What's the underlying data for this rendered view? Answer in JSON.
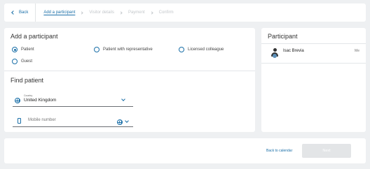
{
  "nav": {
    "back": "Back",
    "steps": [
      "Add a participant",
      "Visitor details",
      "Payment",
      "Confirm"
    ]
  },
  "add_participant": {
    "title": "Add a participant",
    "options": [
      {
        "label": "Patient",
        "selected": true
      },
      {
        "label": "Patient with representative",
        "selected": false
      },
      {
        "label": "Licensed colleague",
        "selected": false
      },
      {
        "label": "Guest",
        "selected": false
      }
    ]
  },
  "find_patient": {
    "title": "Find patient",
    "country_label": "Country",
    "country_value": "United Kingdom",
    "mobile_placeholder": "Mobile number"
  },
  "participant_panel": {
    "title": "Participant",
    "name": "Isac Brevia",
    "tag": "Me"
  },
  "footer": {
    "back_to_calendar": "Back to calendar",
    "next": "Next"
  },
  "colors": {
    "accent": "#1a6fa8",
    "background": "#eef0f2",
    "disabled_button": "#e3e5e7"
  }
}
